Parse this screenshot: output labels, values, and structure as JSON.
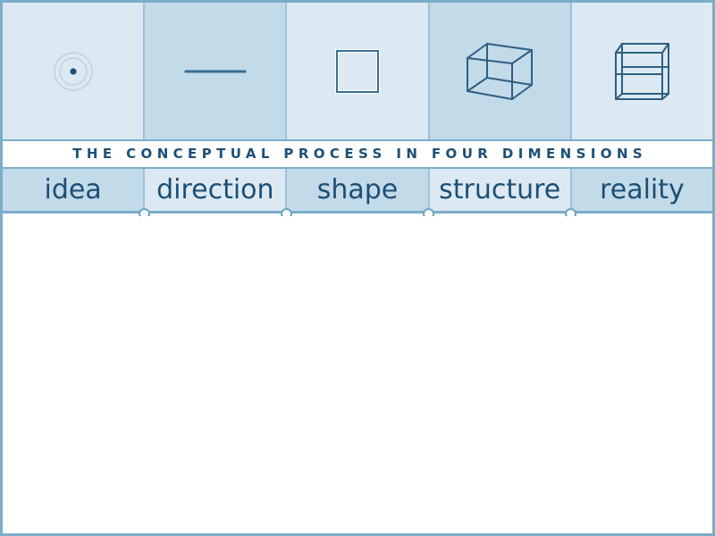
{
  "title": "THE CONCEPTUAL PROCESS IN FOUR DIMENSIONS",
  "colors": {
    "frame_border": "#7badc9",
    "cell_divider": "#9dc3da",
    "tone_light": "#dce9f2",
    "tone_dark": "#c3dae9",
    "ink": "#1d4f75",
    "node_stroke": "#6fa4c4",
    "body_background": "#ffffff"
  },
  "stages": [
    {
      "label": "idea",
      "icon": "point-dot-icon",
      "dimension": "0D",
      "tone": "light",
      "label_tone": "dark"
    },
    {
      "label": "direction",
      "icon": "line-segment-icon",
      "dimension": "1D",
      "tone": "dark",
      "label_tone": "light"
    },
    {
      "label": "shape",
      "icon": "square-outline-icon",
      "dimension": "2D",
      "tone": "light",
      "label_tone": "dark"
    },
    {
      "label": "structure",
      "icon": "wireframe-cube-icon",
      "dimension": "3D",
      "tone": "dark",
      "label_tone": "light"
    },
    {
      "label": "reality",
      "icon": "tesseract-cube-icon",
      "dimension": "4D",
      "tone": "light",
      "label_tone": "dark"
    }
  ],
  "nodes": [
    {
      "name": "node-idea-direction",
      "x_percent": 20
    },
    {
      "name": "node-direction-shape",
      "x_percent": 40
    },
    {
      "name": "node-shape-structure",
      "x_percent": 60
    },
    {
      "name": "node-structure-reality",
      "x_percent": 80
    }
  ]
}
